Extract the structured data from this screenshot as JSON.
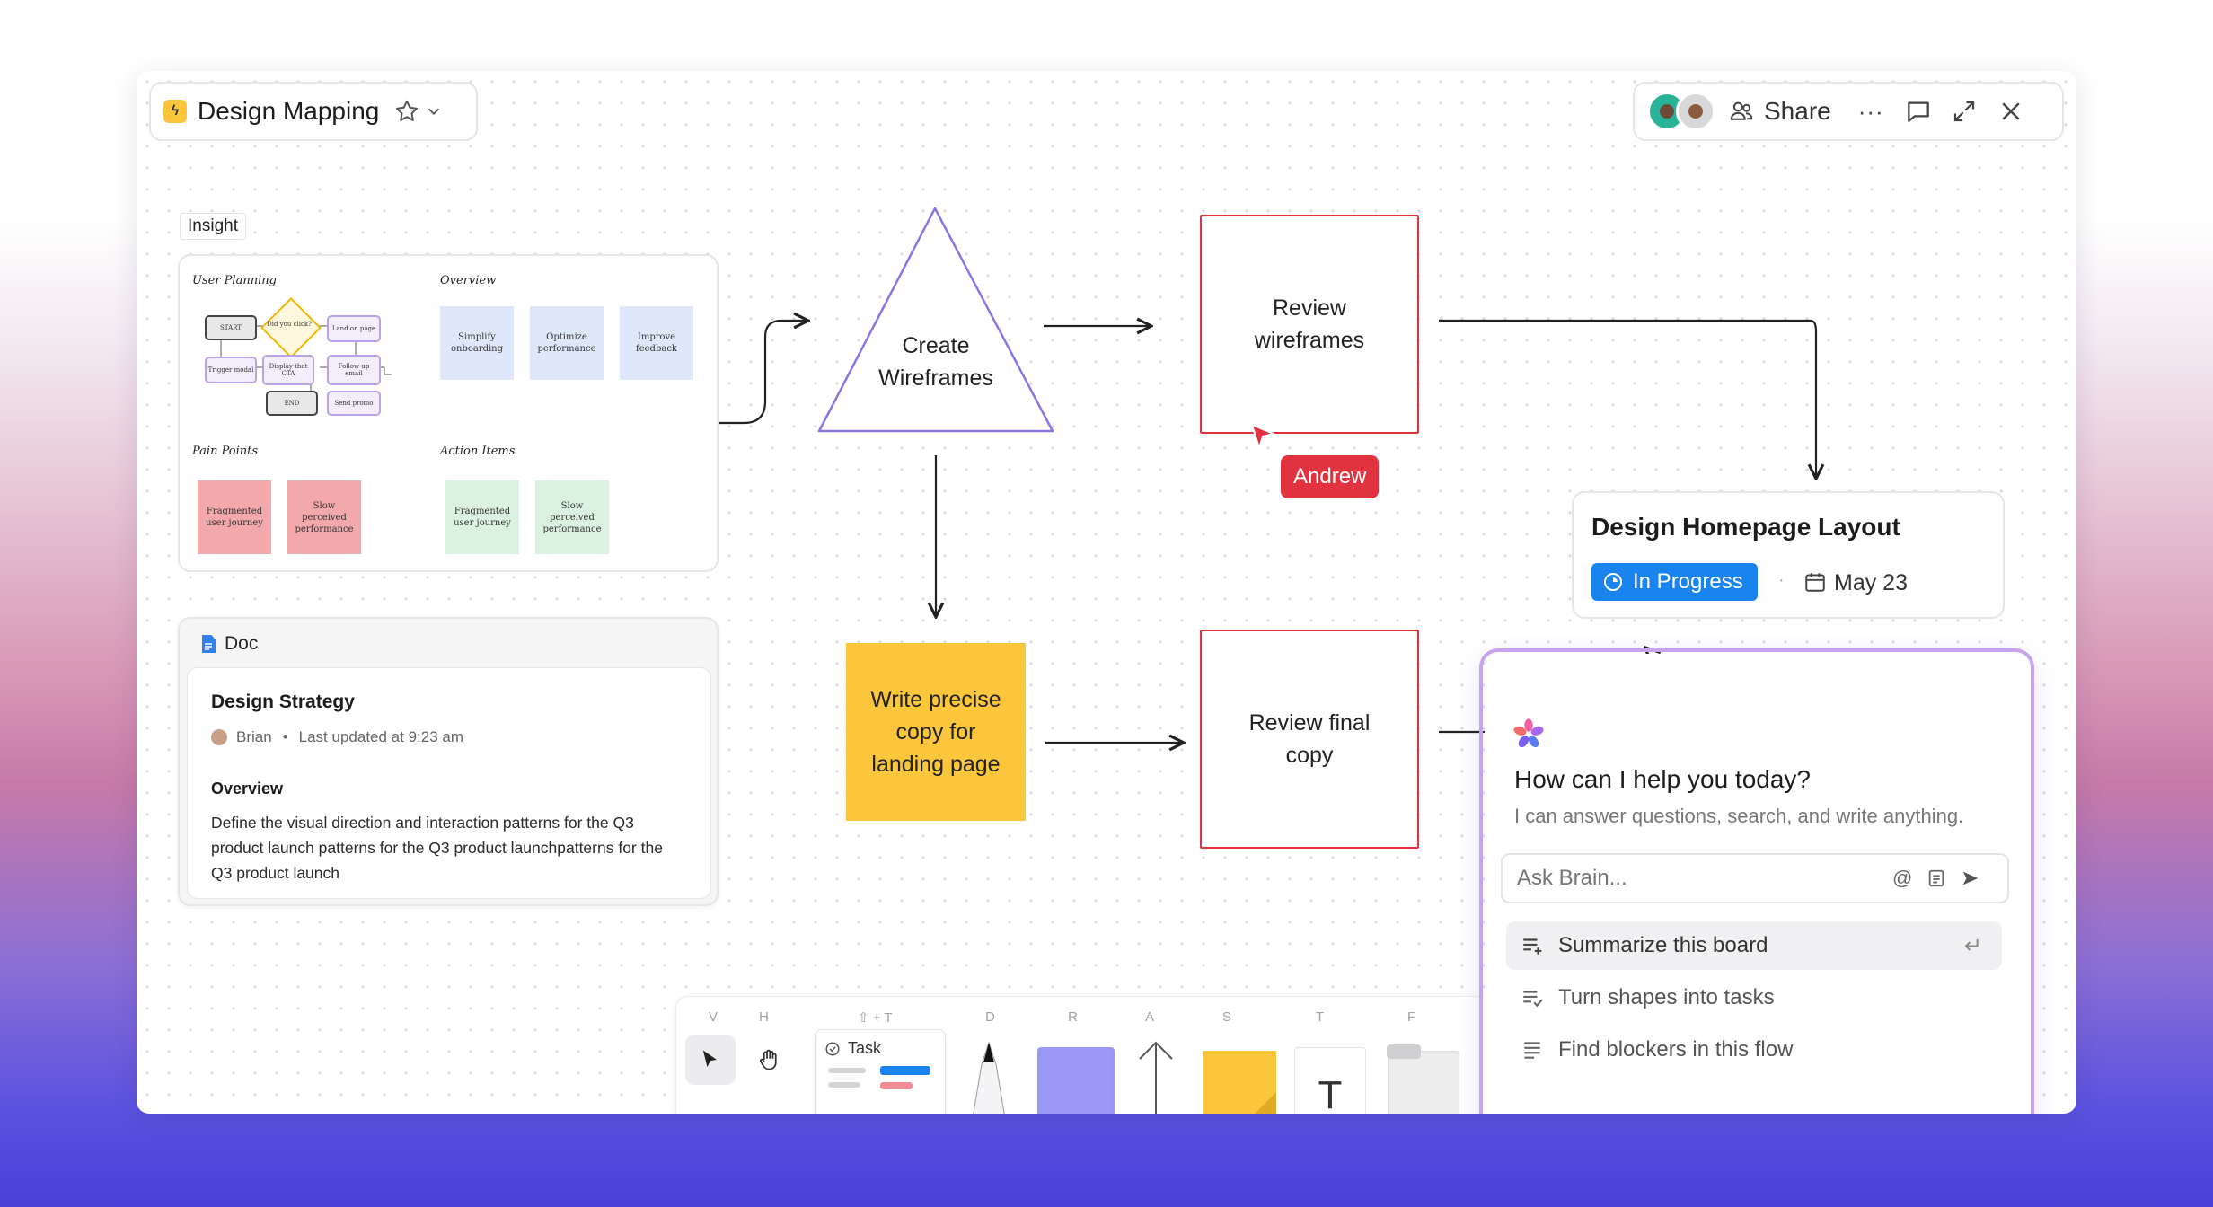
{
  "header": {
    "board_title": "Design Mapping",
    "share_label": "Share",
    "more_icon": "ellipsis-icon"
  },
  "insight": {
    "tag": "Insight",
    "user_planning": {
      "title": "User Planning",
      "nodes": [
        "START",
        "Did you click?",
        "Land on page",
        "Trigger modal",
        "Display that CTA",
        "Follow-up email",
        "END",
        "Send promo"
      ]
    },
    "overview": {
      "title": "Overview",
      "notes": [
        "Simplify onboarding",
        "Optimize performance",
        "Improve feedback"
      ]
    },
    "pain_points": {
      "title": "Pain Points",
      "notes": [
        "Fragmented user journey",
        "Slow perceived performance"
      ]
    },
    "action_items": {
      "title": "Action Items",
      "notes": [
        "Fragmented user journey",
        "Slow perceived performance"
      ]
    }
  },
  "doc": {
    "label": "Doc",
    "title": "Design Strategy",
    "author": "Brian",
    "updated": "Last updated at 9:23 am",
    "section": "Overview",
    "body": "Define the visual direction and interaction patterns for the Q3 product launch patterns for the Q3 product launchpatterns for the Q3 product launch"
  },
  "flow": {
    "triangle": "Create Wireframes",
    "review_wireframes": "Review wireframes",
    "write_copy": "Write precise copy for landing page",
    "review_final": "Review final copy",
    "cursor_user": "Andrew"
  },
  "task_card": {
    "title": "Design Homepage Layout",
    "status": "In Progress",
    "date": "May 23"
  },
  "brain": {
    "heading": "How can I help you today?",
    "subheading": "I can answer questions, search, and write anything.",
    "placeholder": "Ask Brain...",
    "suggestions": [
      "Summarize this board",
      "Turn shapes into tasks",
      "Find blockers in this flow"
    ]
  },
  "toolbar": {
    "keys": [
      "V",
      "H",
      "⇧ + T",
      "D",
      "R",
      "A",
      "S",
      "T",
      "F"
    ],
    "task_label": "Task",
    "text_glyph": "T"
  },
  "colors": {
    "accent_blue": "#1a84ee",
    "red_outline": "#e0323f",
    "sticky_yellow": "#fcc63c",
    "triangle_stroke": "#8a76e6",
    "brain_border": "#b98be8"
  }
}
